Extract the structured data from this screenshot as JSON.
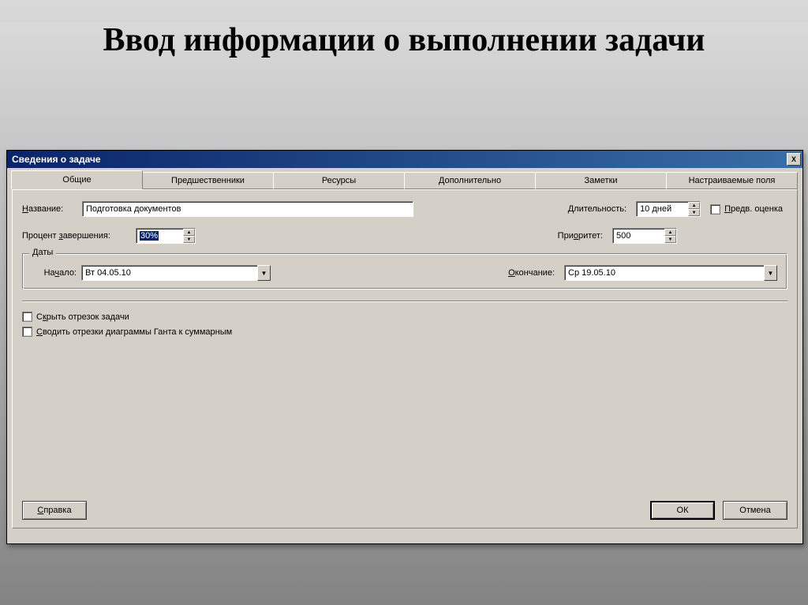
{
  "slide": {
    "title": "Ввод информации о выполнении задачи"
  },
  "window": {
    "title": "Сведения о задаче",
    "close": "X"
  },
  "tabs": {
    "general": "Общие",
    "predecessors": "Предшественники",
    "resources": "Ресурсы",
    "advanced": "Дополнительно",
    "notes": "Заметки",
    "custom": "Настраиваемые поля"
  },
  "fields": {
    "name_label": "Название:",
    "name_value": "Подготовка документов",
    "duration_label": "Длительность:",
    "duration_value": "10 дней",
    "estimated_label": "Предв. оценка",
    "percent_label": "Процент завершения:",
    "percent_value": "30%",
    "priority_label": "Приоритет:",
    "priority_value": "500",
    "dates_legend": "Даты",
    "start_label": "Начало:",
    "start_value": "Вт 04.05.10",
    "finish_label": "Окончание:",
    "finish_value": "Ср 19.05.10",
    "hide_bar_label": "Скрыть отрезок задачи",
    "rollup_label": "Сводить отрезки диаграммы Ганта к суммарным"
  },
  "buttons": {
    "help": "Справка",
    "ok": "ОК",
    "cancel": "Отмена"
  },
  "glyphs": {
    "up": "▲",
    "down": "▼"
  }
}
